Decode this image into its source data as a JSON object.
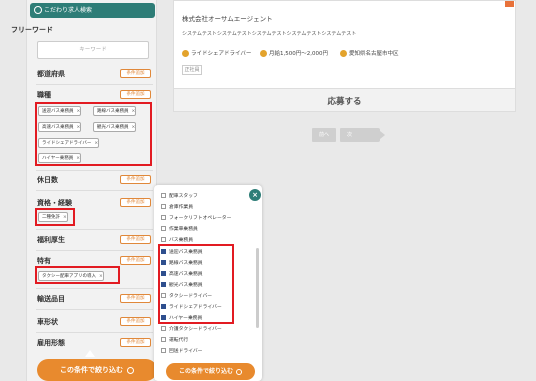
{
  "sidebar": {
    "header": "こだわり求人検索",
    "freeword_label": "フリーワード",
    "freeword_placeholder": "キーワード",
    "add_label": "条件追加",
    "sections": [
      "都道府県",
      "職種",
      "休日数",
      "資格・経験",
      "福利厚生",
      "特有",
      "輸送品目",
      "車形状",
      "雇用形態"
    ],
    "job_tags": [
      "送迎バス乗務員",
      "路線バス乗務員",
      "高速バス乗務員",
      "観光バス乗務員",
      "ライドシェアドライバー",
      "ハイヤー乗務員"
    ],
    "license_tags": [
      "二種免許"
    ],
    "special_tags": [
      "タクシー配車アプリの導入"
    ],
    "apply_button": "この条件で絞り込む"
  },
  "card": {
    "company": "株式会社オーサムエージェント",
    "description": "システムテストシステムテストシステムテストシステムテストシステムテスト",
    "job": "ライドシェアドライバー",
    "salary": "月給1,500円〜2,000円",
    "location": "愛知県名古屋市中区",
    "new_tag": "正社員",
    "apply_label": "応募する"
  },
  "pager": {
    "prev": "前へ",
    "next": "次へ"
  },
  "popup": {
    "options": [
      {
        "label": "配車スタッフ",
        "checked": false
      },
      {
        "label": "倉庫作業員",
        "checked": false
      },
      {
        "label": "フォークリフトオペレーター",
        "checked": false
      },
      {
        "label": "作業車乗務員",
        "checked": false
      },
      {
        "label": "バス乗務員",
        "checked": false
      },
      {
        "label": "送迎バス乗務員",
        "checked": true
      },
      {
        "label": "路線バス乗務員",
        "checked": true
      },
      {
        "label": "高速バス乗務員",
        "checked": true
      },
      {
        "label": "観光バス乗務員",
        "checked": true
      },
      {
        "label": "タクシードライバー",
        "checked": false
      },
      {
        "label": "ライドシェアドライバー",
        "checked": true
      },
      {
        "label": "ハイヤー乗務員",
        "checked": true
      },
      {
        "label": "介護タクシードライバー",
        "checked": false
      },
      {
        "label": "運転代行",
        "checked": false
      },
      {
        "label": "回送ドライバー",
        "checked": false
      }
    ],
    "apply_button": "この条件で絞り込む"
  }
}
